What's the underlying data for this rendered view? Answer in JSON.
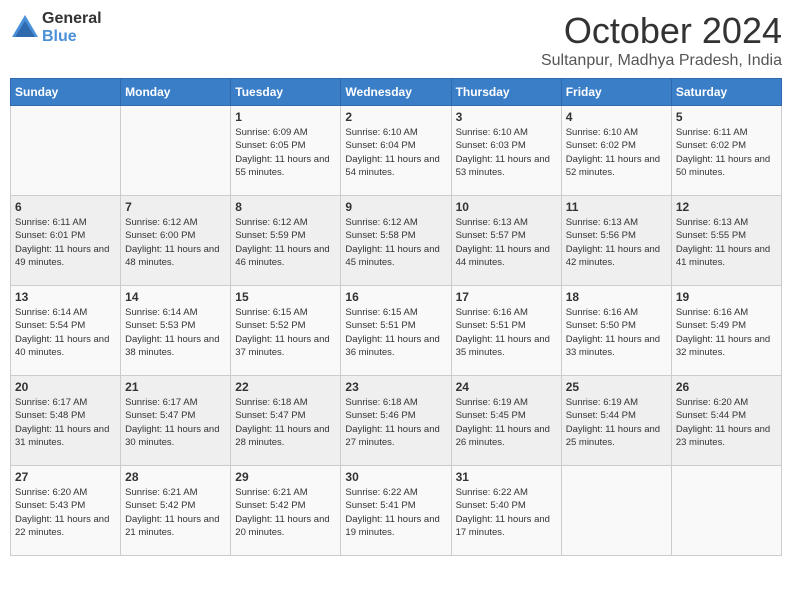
{
  "logo": {
    "general": "General",
    "blue": "Blue"
  },
  "title": "October 2024",
  "location": "Sultanpur, Madhya Pradesh, India",
  "weekdays": [
    "Sunday",
    "Monday",
    "Tuesday",
    "Wednesday",
    "Thursday",
    "Friday",
    "Saturday"
  ],
  "weeks": [
    [
      {
        "day": "",
        "sunrise": "",
        "sunset": "",
        "daylight": ""
      },
      {
        "day": "",
        "sunrise": "",
        "sunset": "",
        "daylight": ""
      },
      {
        "day": "1",
        "sunrise": "Sunrise: 6:09 AM",
        "sunset": "Sunset: 6:05 PM",
        "daylight": "Daylight: 11 hours and 55 minutes."
      },
      {
        "day": "2",
        "sunrise": "Sunrise: 6:10 AM",
        "sunset": "Sunset: 6:04 PM",
        "daylight": "Daylight: 11 hours and 54 minutes."
      },
      {
        "day": "3",
        "sunrise": "Sunrise: 6:10 AM",
        "sunset": "Sunset: 6:03 PM",
        "daylight": "Daylight: 11 hours and 53 minutes."
      },
      {
        "day": "4",
        "sunrise": "Sunrise: 6:10 AM",
        "sunset": "Sunset: 6:02 PM",
        "daylight": "Daylight: 11 hours and 52 minutes."
      },
      {
        "day": "5",
        "sunrise": "Sunrise: 6:11 AM",
        "sunset": "Sunset: 6:02 PM",
        "daylight": "Daylight: 11 hours and 50 minutes."
      }
    ],
    [
      {
        "day": "6",
        "sunrise": "Sunrise: 6:11 AM",
        "sunset": "Sunset: 6:01 PM",
        "daylight": "Daylight: 11 hours and 49 minutes."
      },
      {
        "day": "7",
        "sunrise": "Sunrise: 6:12 AM",
        "sunset": "Sunset: 6:00 PM",
        "daylight": "Daylight: 11 hours and 48 minutes."
      },
      {
        "day": "8",
        "sunrise": "Sunrise: 6:12 AM",
        "sunset": "Sunset: 5:59 PM",
        "daylight": "Daylight: 11 hours and 46 minutes."
      },
      {
        "day": "9",
        "sunrise": "Sunrise: 6:12 AM",
        "sunset": "Sunset: 5:58 PM",
        "daylight": "Daylight: 11 hours and 45 minutes."
      },
      {
        "day": "10",
        "sunrise": "Sunrise: 6:13 AM",
        "sunset": "Sunset: 5:57 PM",
        "daylight": "Daylight: 11 hours and 44 minutes."
      },
      {
        "day": "11",
        "sunrise": "Sunrise: 6:13 AM",
        "sunset": "Sunset: 5:56 PM",
        "daylight": "Daylight: 11 hours and 42 minutes."
      },
      {
        "day": "12",
        "sunrise": "Sunrise: 6:13 AM",
        "sunset": "Sunset: 5:55 PM",
        "daylight": "Daylight: 11 hours and 41 minutes."
      }
    ],
    [
      {
        "day": "13",
        "sunrise": "Sunrise: 6:14 AM",
        "sunset": "Sunset: 5:54 PM",
        "daylight": "Daylight: 11 hours and 40 minutes."
      },
      {
        "day": "14",
        "sunrise": "Sunrise: 6:14 AM",
        "sunset": "Sunset: 5:53 PM",
        "daylight": "Daylight: 11 hours and 38 minutes."
      },
      {
        "day": "15",
        "sunrise": "Sunrise: 6:15 AM",
        "sunset": "Sunset: 5:52 PM",
        "daylight": "Daylight: 11 hours and 37 minutes."
      },
      {
        "day": "16",
        "sunrise": "Sunrise: 6:15 AM",
        "sunset": "Sunset: 5:51 PM",
        "daylight": "Daylight: 11 hours and 36 minutes."
      },
      {
        "day": "17",
        "sunrise": "Sunrise: 6:16 AM",
        "sunset": "Sunset: 5:51 PM",
        "daylight": "Daylight: 11 hours and 35 minutes."
      },
      {
        "day": "18",
        "sunrise": "Sunrise: 6:16 AM",
        "sunset": "Sunset: 5:50 PM",
        "daylight": "Daylight: 11 hours and 33 minutes."
      },
      {
        "day": "19",
        "sunrise": "Sunrise: 6:16 AM",
        "sunset": "Sunset: 5:49 PM",
        "daylight": "Daylight: 11 hours and 32 minutes."
      }
    ],
    [
      {
        "day": "20",
        "sunrise": "Sunrise: 6:17 AM",
        "sunset": "Sunset: 5:48 PM",
        "daylight": "Daylight: 11 hours and 31 minutes."
      },
      {
        "day": "21",
        "sunrise": "Sunrise: 6:17 AM",
        "sunset": "Sunset: 5:47 PM",
        "daylight": "Daylight: 11 hours and 30 minutes."
      },
      {
        "day": "22",
        "sunrise": "Sunrise: 6:18 AM",
        "sunset": "Sunset: 5:47 PM",
        "daylight": "Daylight: 11 hours and 28 minutes."
      },
      {
        "day": "23",
        "sunrise": "Sunrise: 6:18 AM",
        "sunset": "Sunset: 5:46 PM",
        "daylight": "Daylight: 11 hours and 27 minutes."
      },
      {
        "day": "24",
        "sunrise": "Sunrise: 6:19 AM",
        "sunset": "Sunset: 5:45 PM",
        "daylight": "Daylight: 11 hours and 26 minutes."
      },
      {
        "day": "25",
        "sunrise": "Sunrise: 6:19 AM",
        "sunset": "Sunset: 5:44 PM",
        "daylight": "Daylight: 11 hours and 25 minutes."
      },
      {
        "day": "26",
        "sunrise": "Sunrise: 6:20 AM",
        "sunset": "Sunset: 5:44 PM",
        "daylight": "Daylight: 11 hours and 23 minutes."
      }
    ],
    [
      {
        "day": "27",
        "sunrise": "Sunrise: 6:20 AM",
        "sunset": "Sunset: 5:43 PM",
        "daylight": "Daylight: 11 hours and 22 minutes."
      },
      {
        "day": "28",
        "sunrise": "Sunrise: 6:21 AM",
        "sunset": "Sunset: 5:42 PM",
        "daylight": "Daylight: 11 hours and 21 minutes."
      },
      {
        "day": "29",
        "sunrise": "Sunrise: 6:21 AM",
        "sunset": "Sunset: 5:42 PM",
        "daylight": "Daylight: 11 hours and 20 minutes."
      },
      {
        "day": "30",
        "sunrise": "Sunrise: 6:22 AM",
        "sunset": "Sunset: 5:41 PM",
        "daylight": "Daylight: 11 hours and 19 minutes."
      },
      {
        "day": "31",
        "sunrise": "Sunrise: 6:22 AM",
        "sunset": "Sunset: 5:40 PM",
        "daylight": "Daylight: 11 hours and 17 minutes."
      },
      {
        "day": "",
        "sunrise": "",
        "sunset": "",
        "daylight": ""
      },
      {
        "day": "",
        "sunrise": "",
        "sunset": "",
        "daylight": ""
      }
    ]
  ]
}
